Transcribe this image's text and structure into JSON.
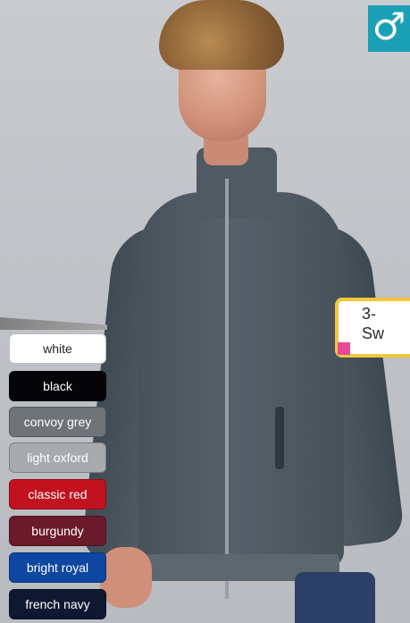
{
  "badge": {
    "icon": "male-symbol-icon",
    "symbol": "♂",
    "color": "#1aa0b6"
  },
  "teaser": {
    "line1": "3-",
    "line2": "Sw"
  },
  "colors": [
    {
      "name": "white",
      "hex": "#ffffff"
    },
    {
      "name": "black",
      "hex": "#050508"
    },
    {
      "name": "convoy grey",
      "hex": "#6f7478"
    },
    {
      "name": "light oxford",
      "hex": "#a7abae"
    },
    {
      "name": "classic red",
      "hex": "#c2121f"
    },
    {
      "name": "burgundy",
      "hex": "#6a1a2a"
    },
    {
      "name": "bright royal",
      "hex": "#0d47a1"
    },
    {
      "name": "french navy",
      "hex": "#0f1830"
    }
  ]
}
